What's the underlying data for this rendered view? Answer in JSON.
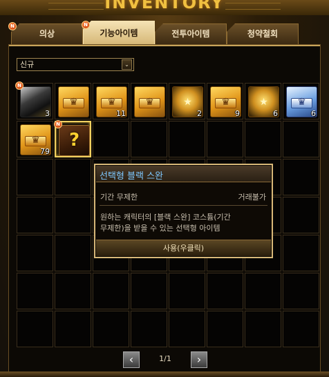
{
  "window": {
    "title": "INVENTORY"
  },
  "tabs": [
    {
      "label": "의상",
      "badge": "N"
    },
    {
      "label": "기능아이템",
      "badge": "N",
      "active": true
    },
    {
      "label": "전투아이템"
    },
    {
      "label": "청약철회"
    }
  ],
  "filter": {
    "selected": "신규",
    "arrow": "⌄"
  },
  "items": [
    {
      "kind": "book",
      "count": "3",
      "badge": "N"
    },
    {
      "kind": "gold",
      "count": ""
    },
    {
      "kind": "gold",
      "count": "11"
    },
    {
      "kind": "gold",
      "count": ""
    },
    {
      "kind": "goldstar",
      "count": "2"
    },
    {
      "kind": "gold",
      "count": "9"
    },
    {
      "kind": "goldstar",
      "count": "6"
    },
    {
      "kind": "silver",
      "count": "6"
    },
    {
      "kind": "gold",
      "count": "79"
    },
    {
      "kind": "box",
      "count": "",
      "badge": "N",
      "icon": "?"
    }
  ],
  "tooltip": {
    "name": "선택형 블랙 스완",
    "duration": "기간 무제한",
    "trade": "거래불가",
    "desc_line1": "원하는 캐릭터의 [블랙 스완] 코스튬(기간",
    "desc_line2": "무제한)을 받을 수 있는 선택형 아이템",
    "use_label": "사용(우클릭)"
  },
  "pager": {
    "prev": "‹",
    "next": "›",
    "text": "1/1"
  },
  "colors": {
    "accent": "#f0c040",
    "tooltip_name": "#7ec8ff",
    "active_tab": "#f4e2b4"
  }
}
